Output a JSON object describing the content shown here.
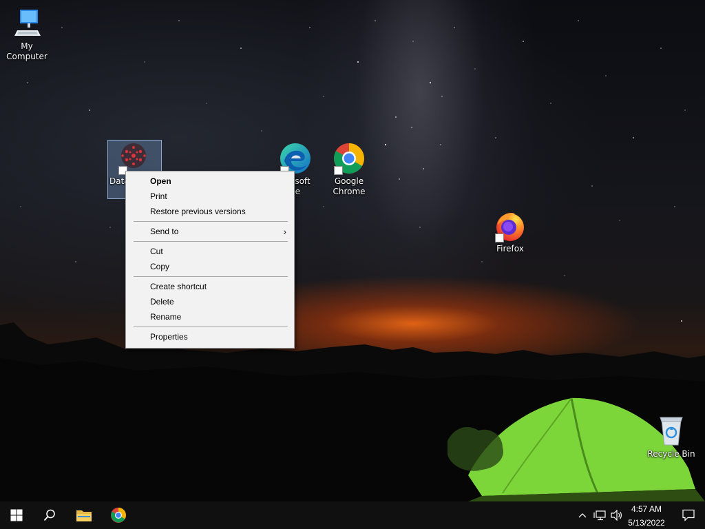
{
  "desktop": {
    "icons": [
      {
        "label": "My Computer"
      },
      {
        "label": "Data"
      },
      {
        "label": "Microsoft Edge",
        "visible_label_1": "osoft",
        "visible_label_2": "ge"
      },
      {
        "label_line1": "Google",
        "label_line2": "Chrome"
      },
      {
        "label": "Firefox"
      },
      {
        "label": "Recycle Bin"
      }
    ]
  },
  "context_menu": {
    "items": [
      {
        "label": "Open"
      },
      {
        "label": "Print"
      },
      {
        "label": "Restore previous versions"
      },
      {
        "label": "Send to"
      },
      {
        "label": "Cut"
      },
      {
        "label": "Copy"
      },
      {
        "label": "Create shortcut"
      },
      {
        "label": "Delete"
      },
      {
        "label": "Rename"
      },
      {
        "label": "Properties"
      }
    ]
  },
  "taskbar": {
    "time": "4:57 AM",
    "date": "5/13/2022"
  },
  "colors": {
    "taskbar_bg": "#101010",
    "menu_bg": "#f2f2f2",
    "tent_green": "#7cd63a",
    "horizon_glow": "#ff6a14"
  }
}
